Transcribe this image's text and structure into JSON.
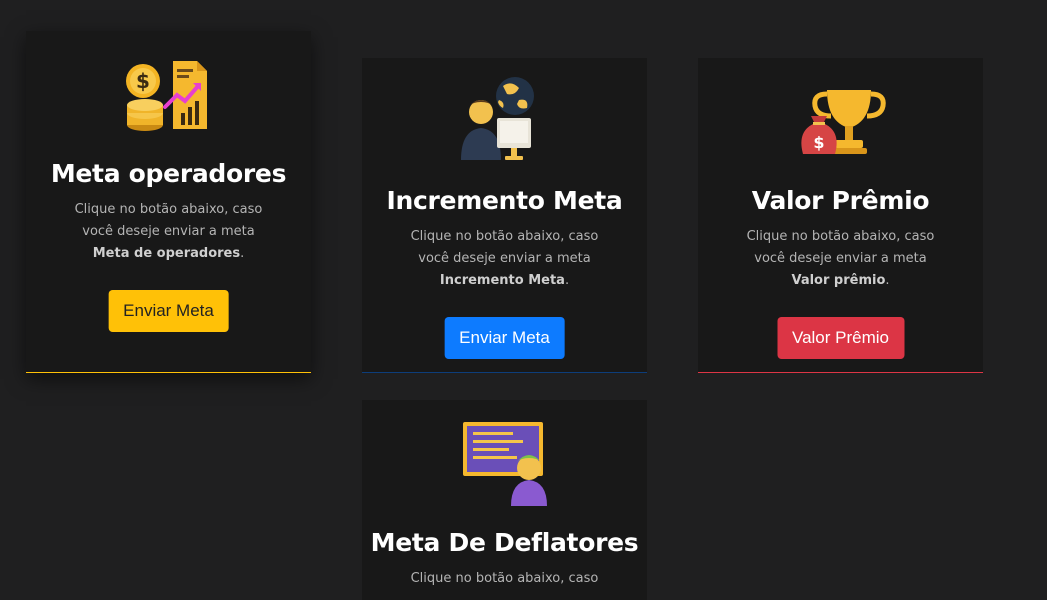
{
  "cards": [
    {
      "icon": "money-growth-icon",
      "title": "Meta operadores",
      "desc_prefix": "Clique no botão abaixo, caso você deseje enviar a meta ",
      "desc_bold": "Meta de operadores",
      "desc_suffix": ".",
      "button_label": "Enviar Meta",
      "accent": "#ffc107"
    },
    {
      "icon": "person-globe-computer-icon",
      "title": "Incremento Meta",
      "desc_prefix": "Clique no botão abaixo, caso você deseje enviar a meta ",
      "desc_bold": "Incremento Meta",
      "desc_suffix": ".",
      "button_label": "Enviar Meta",
      "accent": "#0d6efd"
    },
    {
      "icon": "trophy-money-bag-icon",
      "title": "Valor Prêmio",
      "desc_prefix": "Clique no botão abaixo, caso você deseje enviar a meta ",
      "desc_bold": "Valor prêmio",
      "desc_suffix": ".",
      "button_label": "Valor Prêmio",
      "accent": "#dc3545"
    },
    {
      "icon": "presenter-board-icon",
      "title": "Meta De Deflatores",
      "desc_prefix": "Clique no botão abaixo, caso",
      "desc_bold": "",
      "desc_suffix": "",
      "button_label": "",
      "accent": "#6f42c1"
    }
  ]
}
